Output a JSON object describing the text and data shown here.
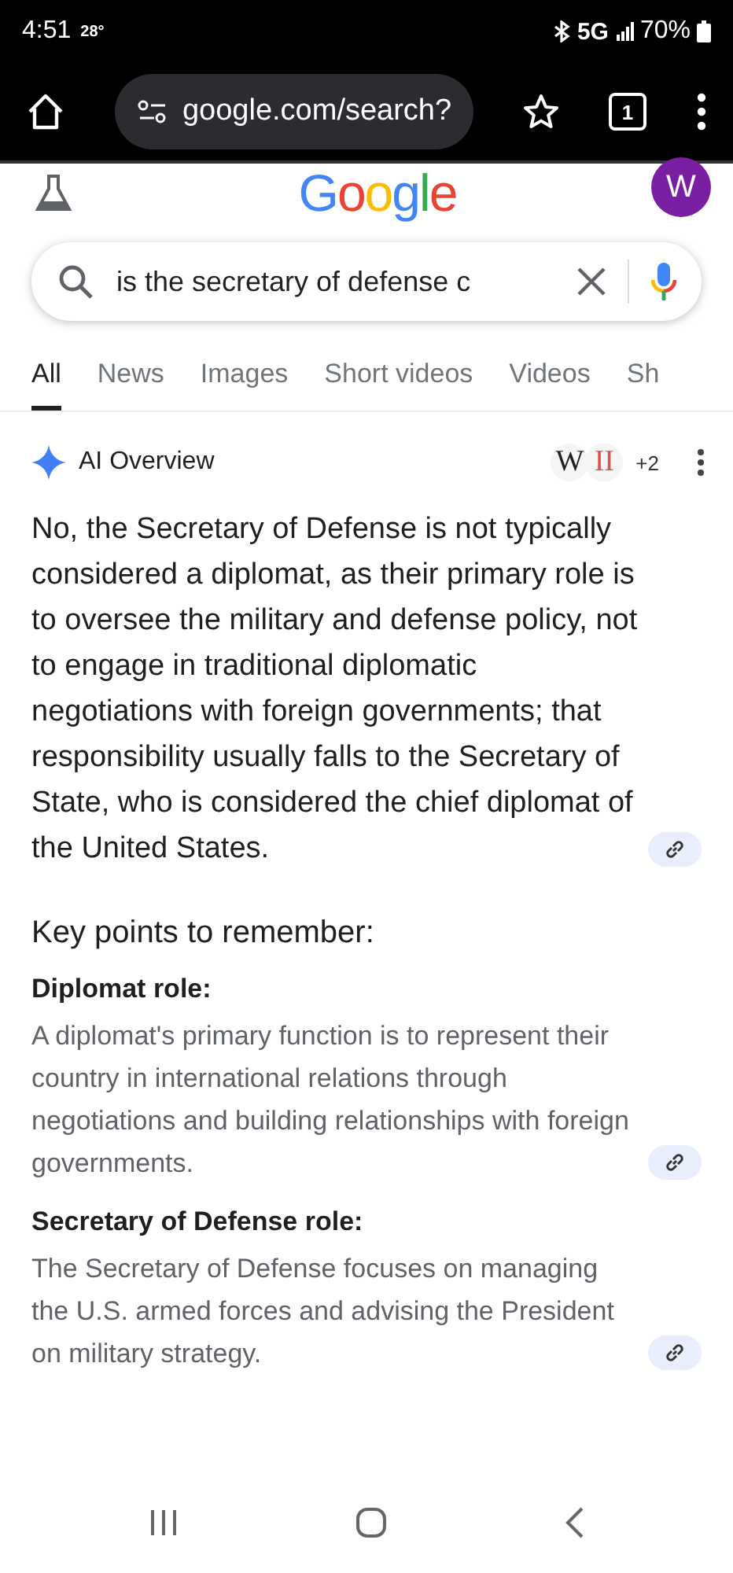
{
  "status_bar": {
    "time": "4:51",
    "temperature": "28°",
    "network": "5G",
    "battery": "70%"
  },
  "browser": {
    "url": "google.com/search?",
    "tab_count": "1"
  },
  "header": {
    "logo": "Google",
    "avatar": "W"
  },
  "search": {
    "value": "is the secretary of defense c"
  },
  "tabs": [
    {
      "label": "All",
      "selected": true
    },
    {
      "label": "News",
      "selected": false
    },
    {
      "label": "Images",
      "selected": false
    },
    {
      "label": "Short videos",
      "selected": false
    },
    {
      "label": "Videos",
      "selected": false
    },
    {
      "label": "Sh",
      "selected": false
    }
  ],
  "ai_overview": {
    "title": "AI Overview",
    "sources": [
      "W",
      "II"
    ],
    "more_sources": "+2",
    "summary": "No, the Secretary of Defense is not typically considered a diplomat, as their primary role is to oversee the military and defense policy, not to engage in traditional diplomatic negotiations with foreign governments; that responsibility usually falls to the Secretary of State, who is considered the chief diplomat of the United States.",
    "heading": "Key points to remember:",
    "points": [
      {
        "title": "Diplomat role:",
        "text": "A diplomat's primary function is to represent their country in international relations through negotiations and building relationships with foreign governments."
      },
      {
        "title": "Secretary of Defense role:",
        "text": "The Secretary of Defense focuses on managing the U.S. armed forces and advising the President on military strategy."
      }
    ]
  }
}
